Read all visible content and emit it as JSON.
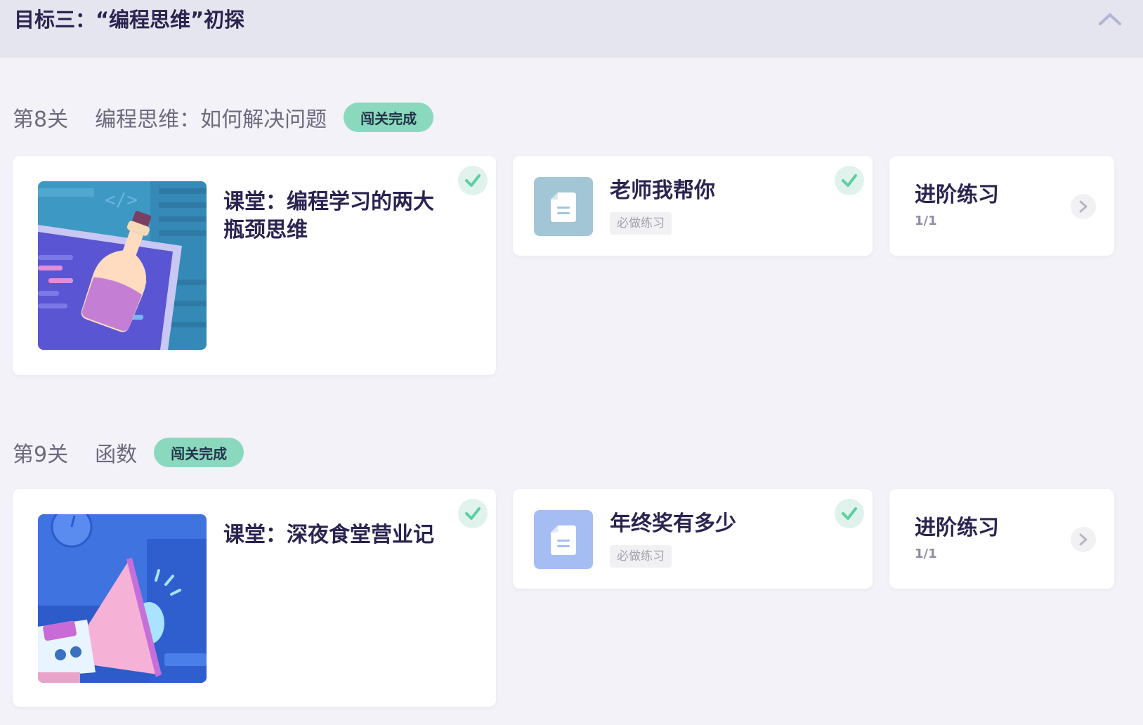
{
  "goal": {
    "title": "目标三：“编程思维”初探",
    "collapse_icon": "chevron-up-icon"
  },
  "levels": [
    {
      "number": "第8关",
      "name": "编程思维：如何解决问题",
      "badge": "闯关完成",
      "lesson": {
        "title": "课堂：编程学习的两大瓶颈思维",
        "thumbnail": "potion-bottle-code-illustration",
        "completed": true
      },
      "exercise": {
        "title": "老师我帮你",
        "tag": "必做练习",
        "icon": "document-icon",
        "icon_color": "#a2c6d6",
        "completed": true
      },
      "advanced": {
        "title": "进阶练习",
        "progress": "1/1"
      }
    },
    {
      "number": "第9关",
      "name": "函数",
      "badge": "闯关完成",
      "lesson": {
        "title": "课堂：深夜食堂营业记",
        "thumbnail": "megaphone-illustration",
        "completed": true
      },
      "exercise": {
        "title": "年终奖有多少",
        "tag": "必做练习",
        "icon": "document-icon",
        "icon_color": "#a6bdf4",
        "completed": true
      },
      "advanced": {
        "title": "进阶练习",
        "progress": "1/1"
      }
    }
  ],
  "colors": {
    "background": "#f2f2f8",
    "header": "#e5e5ef",
    "badge": "#8ad8bd",
    "check": "#5ccfa3",
    "title_text": "#2b2350"
  }
}
